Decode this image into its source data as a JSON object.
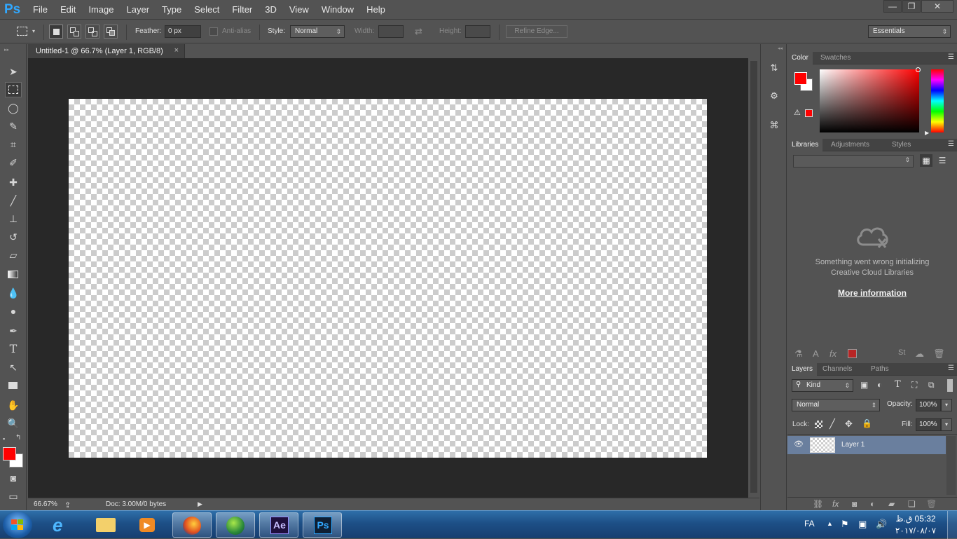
{
  "app": {
    "logo": "Ps",
    "accent": "#31a8ff"
  },
  "menu": [
    "File",
    "Edit",
    "Image",
    "Layer",
    "Type",
    "Select",
    "Filter",
    "3D",
    "View",
    "Window",
    "Help"
  ],
  "window_controls": {
    "minimize": "—",
    "restore": "❐",
    "close": "✕"
  },
  "options": {
    "feather_label": "Feather:",
    "feather_value": "0 px",
    "antialias_label": "Anti-alias",
    "style_label": "Style:",
    "style_value": "Normal",
    "width_label": "Width:",
    "height_label": "Height:",
    "refine_label": "Refine Edge...",
    "workspace_value": "Essentials"
  },
  "document": {
    "tab_title": "Untitled-1 @ 66.7% (Layer 1, RGB/8)",
    "tab_close": "×"
  },
  "status": {
    "zoom": "66.67%",
    "doc": "Doc: 3.00M/0 bytes"
  },
  "panels": {
    "color_tabs": [
      "Color",
      "Swatches"
    ],
    "library_tabs": [
      "Libraries",
      "Adjustments",
      "Styles"
    ],
    "library_error_line1": "Something went wrong initializing",
    "library_error_line2": "Creative Cloud Libraries",
    "library_more": "More information",
    "layers_tabs": [
      "Layers",
      "Channels",
      "Paths"
    ],
    "kind_label": "Kind",
    "blend_mode": "Normal",
    "opacity_label": "Opacity:",
    "opacity_value": "100%",
    "lock_label": "Lock:",
    "fill_label": "Fill:",
    "fill_value": "100%",
    "layer_name": "Layer 1",
    "foreground_color": "#ff0000",
    "background_color": "#ffffff"
  },
  "taskbar": {
    "lang": "FA",
    "time": "05:32 ق.ظ",
    "date": "۲۰۱۷/۰۸/۰۷",
    "ae_label": "Ae",
    "ps_label": "Ps"
  }
}
